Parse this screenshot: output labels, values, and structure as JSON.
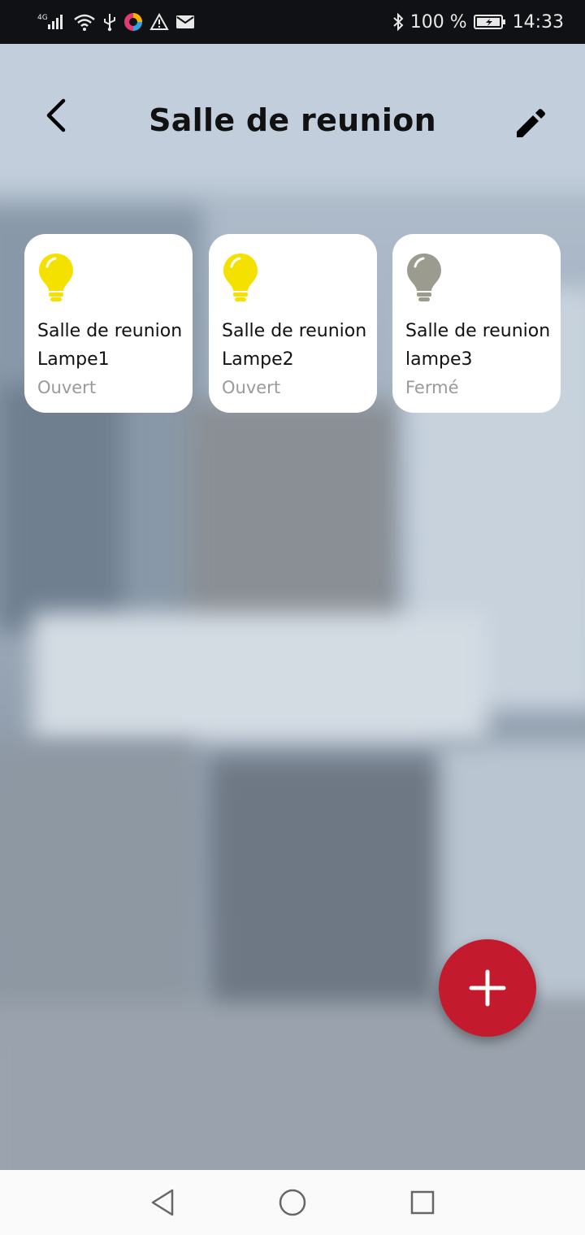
{
  "status_bar": {
    "network": "4G",
    "battery_percent": "100 %",
    "time": "14:33",
    "icons": [
      "signal-icon",
      "wifi-icon",
      "usb-icon",
      "app-icon",
      "warning-icon",
      "mail-icon",
      "bluetooth-icon",
      "battery-charging-icon"
    ]
  },
  "header": {
    "title": "Salle de reunion",
    "back_icon": "chevron-left-icon",
    "edit_icon": "pencil-icon"
  },
  "devices": [
    {
      "name_line1": "Salle de reunion",
      "name_line2": "Lampe1",
      "state": "Ouvert",
      "bulb_color": "#f5e100",
      "on": true
    },
    {
      "name_line1": "Salle de reunion",
      "name_line2": "Lampe2",
      "state": "Ouvert",
      "bulb_color": "#f5e100",
      "on": true
    },
    {
      "name_line1": "Salle de reunion",
      "name_line2": "lampe3",
      "state": "Fermé",
      "bulb_color": "#9b9b8f",
      "on": false
    }
  ],
  "fab": {
    "icon": "plus-icon",
    "color": "#c41a2e"
  },
  "nav_bar": {
    "icons": [
      "back-triangle-icon",
      "home-circle-icon",
      "recents-square-icon"
    ]
  }
}
